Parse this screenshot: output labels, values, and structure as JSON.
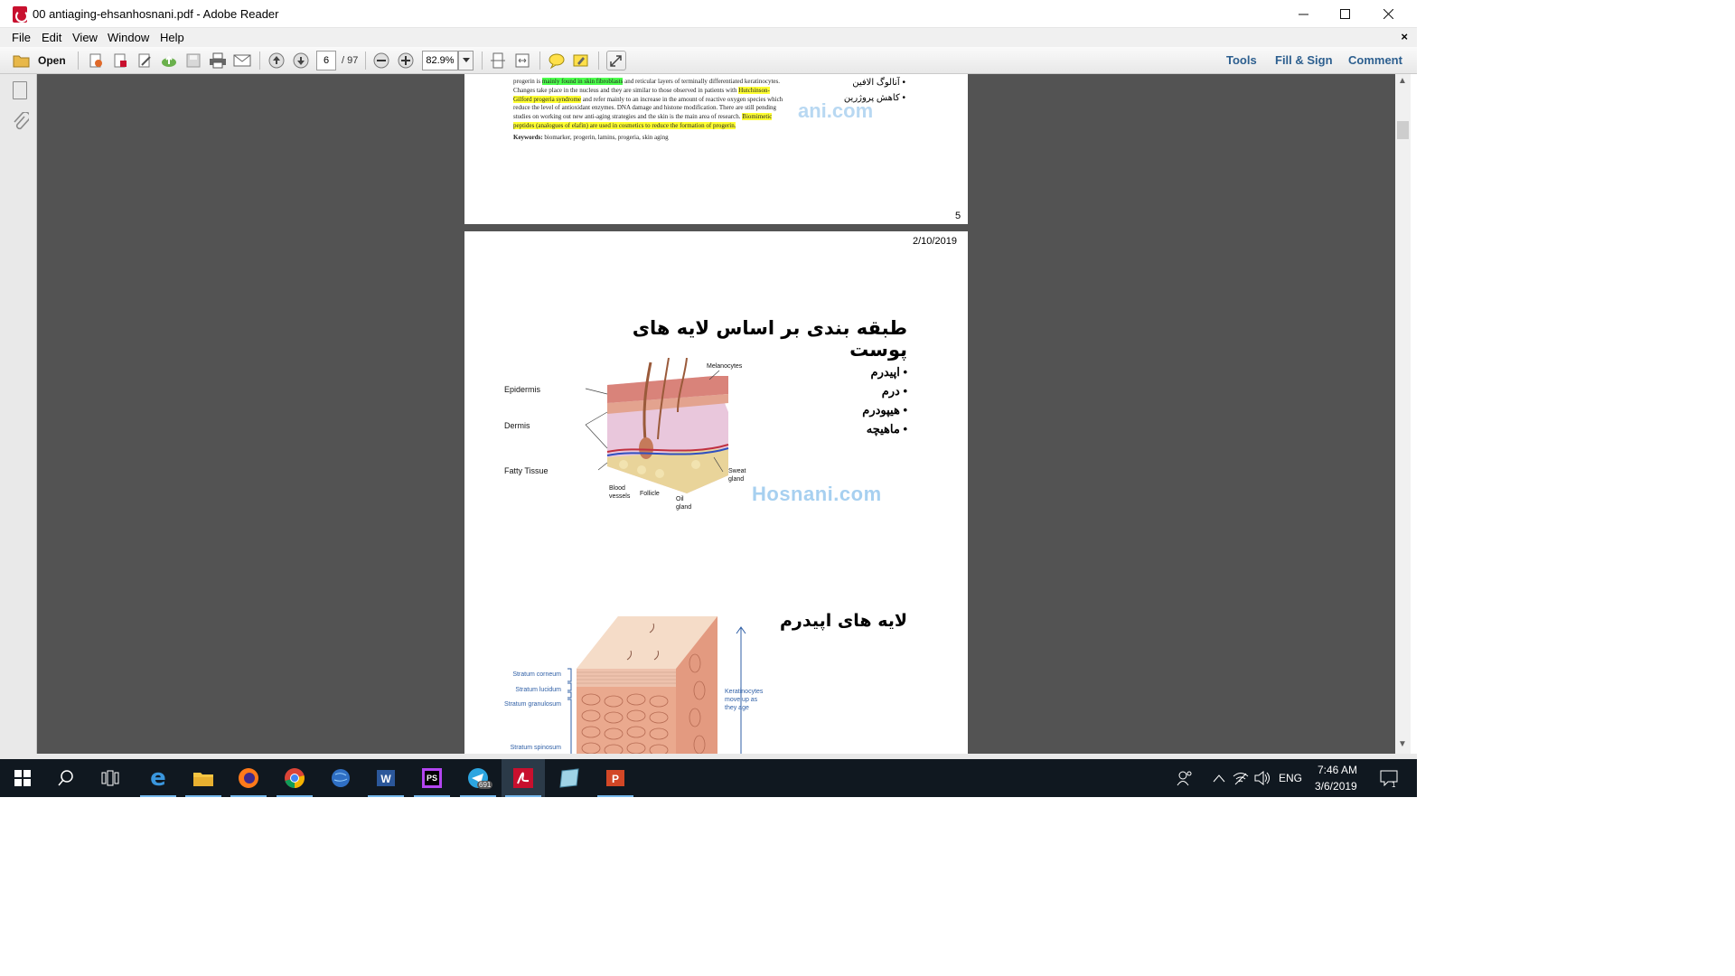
{
  "window": {
    "title": "00 antiaging-ehsanhosnani.pdf - Adobe Reader"
  },
  "menu": {
    "file": "File",
    "edit": "Edit",
    "view": "View",
    "window": "Window",
    "help": "Help"
  },
  "toolbar": {
    "open_label": "Open",
    "page_current": "6",
    "page_total": "/ 97",
    "zoom": "82.9%",
    "tools": "Tools",
    "fill_sign": "Fill & Sign",
    "comment": "Comment"
  },
  "page5": {
    "line1a": "progerin is ",
    "line1_hl": "mainly found in skin fibroblasts",
    "line1b": " and reticular layers of terminally differentiated keratinocytes.",
    "line2a": "Changes take place in the nucleus and they are similar to those observed in patients with ",
    "line2_hl": "Hutchinson-",
    "line3_hl": "Gilford progeria syndrome",
    "line3b": " and refer mainly to an increase in the amount of reactive oxygen species which",
    "line4": "reduce the level of antioxidant enzymes. DNA damage and histone modification. There are still pending",
    "line5a": "studies on working out new anti-aging strategies and the skin is the main area of research. ",
    "line5_hl": "Biomimetic",
    "line6_hl": "peptides (analogues of elafin) are used in cosmetics to reduce the formation of progerin.",
    "keywords_label": "Keywords:",
    "keywords": " biomarker, progerin, lamins, progeria, skin aging",
    "bullet1": "آنالوگ الافین",
    "bullet2": "کاهش پروژرین",
    "watermark": "ani.com",
    "page_number": "5"
  },
  "page6": {
    "date": "2/10/2019",
    "heading1": "طبقه بندی بر اساس لایه های پوست",
    "bullets": [
      "اپیدرم",
      "درم",
      "هیپودرم",
      "ماهیچه"
    ],
    "fig1_labels": {
      "epidermis": "Epidermis",
      "dermis": "Dermis",
      "fatty": "Fatty Tissue",
      "melanocytes": "Melanocytes",
      "sweat": "Sweat",
      "gland": "gland",
      "blood": "Blood",
      "vessels": "vessels",
      "follicle": "Follicle",
      "oil": "Oil",
      "oil_gland": "gland"
    },
    "watermark": "Hosnani.com",
    "heading2": "لایه های اپیدرم",
    "fig2_labels": {
      "corneum": "Stratum corneum",
      "lucidum": "Stratum lucidum",
      "granulosum": "Stratum granulosum",
      "spinosum": "Stratum spinosum",
      "kera1": "Keratinocytes",
      "kera2": "move up as",
      "kera3": "they age"
    }
  },
  "tray": {
    "lang": "ENG",
    "time": "7:46 AM",
    "date": "3/6/2019",
    "telegram_badge": "691",
    "notif_count": "1"
  },
  "colors": {
    "viewport_bg": "#535353",
    "taskbar_bg": "#101820",
    "link_blue": "#2d5f8f",
    "diagram_blue": "#2f5fa6"
  }
}
